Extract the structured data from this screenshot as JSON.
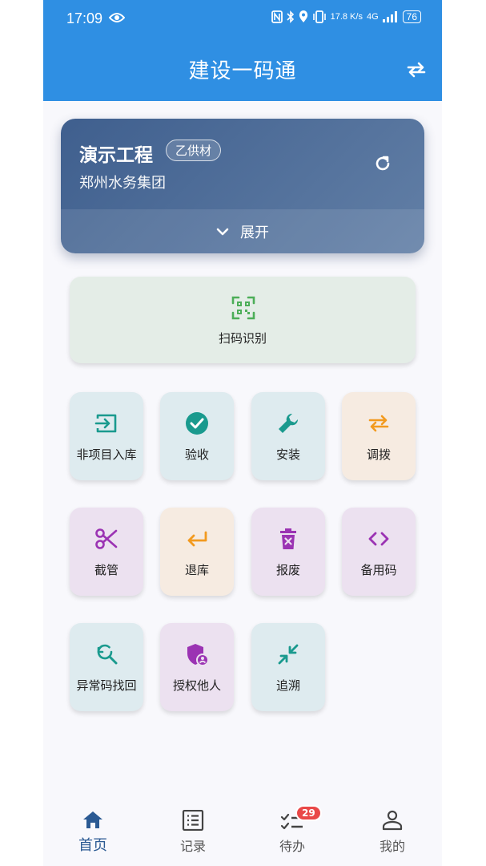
{
  "status_bar": {
    "time": "17:09",
    "speed": "17.8 K/s",
    "network": "4G",
    "battery": "76"
  },
  "app_bar": {
    "title": "建设一码通"
  },
  "project": {
    "name": "演示工程",
    "badge": "乙供材",
    "org": "郑州水务集团",
    "expand_label": "展开"
  },
  "scan": {
    "label": "扫码识别"
  },
  "tiles": [
    {
      "label": "非项目入库",
      "icon": "login-icon",
      "color": "#1a9a8e"
    },
    {
      "label": "验收",
      "icon": "check-circle-icon",
      "color": "#1a9a8e"
    },
    {
      "label": "安装",
      "icon": "wrench-icon",
      "color": "#1a9a8e"
    },
    {
      "label": "调拨",
      "icon": "swap-icon",
      "color": "#f29a1f"
    },
    {
      "label": "截管",
      "icon": "scissors-icon",
      "color": "#9b33b3"
    },
    {
      "label": "退库",
      "icon": "return-icon",
      "color": "#f29a1f"
    },
    {
      "label": "报废",
      "icon": "delete-icon",
      "color": "#9b33b3"
    },
    {
      "label": "备用码",
      "icon": "code-icon",
      "color": "#9b33b3"
    },
    {
      "label": "异常码找回",
      "icon": "search-refresh-icon",
      "color": "#1a9a8e"
    },
    {
      "label": "授权他人",
      "icon": "shield-person-icon",
      "color": "#9b33b3"
    },
    {
      "label": "追溯",
      "icon": "compress-icon",
      "color": "#1a9a8e"
    }
  ],
  "bottom_nav": [
    {
      "label": "首页",
      "icon": "home-icon",
      "active": true
    },
    {
      "label": "记录",
      "icon": "list-icon"
    },
    {
      "label": "待办",
      "icon": "checklist-icon",
      "badge": "29"
    },
    {
      "label": "我的",
      "icon": "person-icon"
    }
  ],
  "colors": {
    "primary": "#2f8fe3",
    "card": "#4b6b98",
    "active_nav": "#2b5a93",
    "badge": "#e94848"
  }
}
